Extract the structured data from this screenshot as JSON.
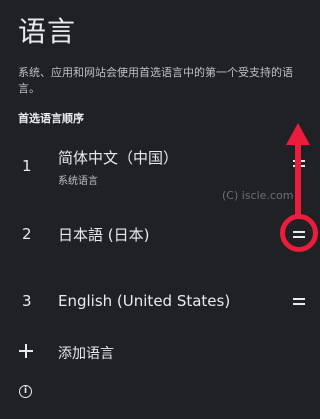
{
  "page": {
    "title": "语言",
    "description": "系统、应用和网站会使用首选语言中的第一个受支持的语言。",
    "section_header": "首选语言顺序"
  },
  "languages": [
    {
      "number": "1",
      "name": "简体中文（中国）",
      "subtitle": "系统语言"
    },
    {
      "number": "2",
      "name": "日本語 (日本)",
      "subtitle": ""
    },
    {
      "number": "3",
      "name": "English (United States)",
      "subtitle": ""
    }
  ],
  "add_language": {
    "label": "添加语言",
    "icon": "plus-icon"
  },
  "info": {
    "icon": "info-icon",
    "glyph": "i"
  },
  "watermark": "(C) iscle.com",
  "colors": {
    "background": "#202124",
    "text": "#e8eaed",
    "annotation": "#ec1c3c"
  }
}
